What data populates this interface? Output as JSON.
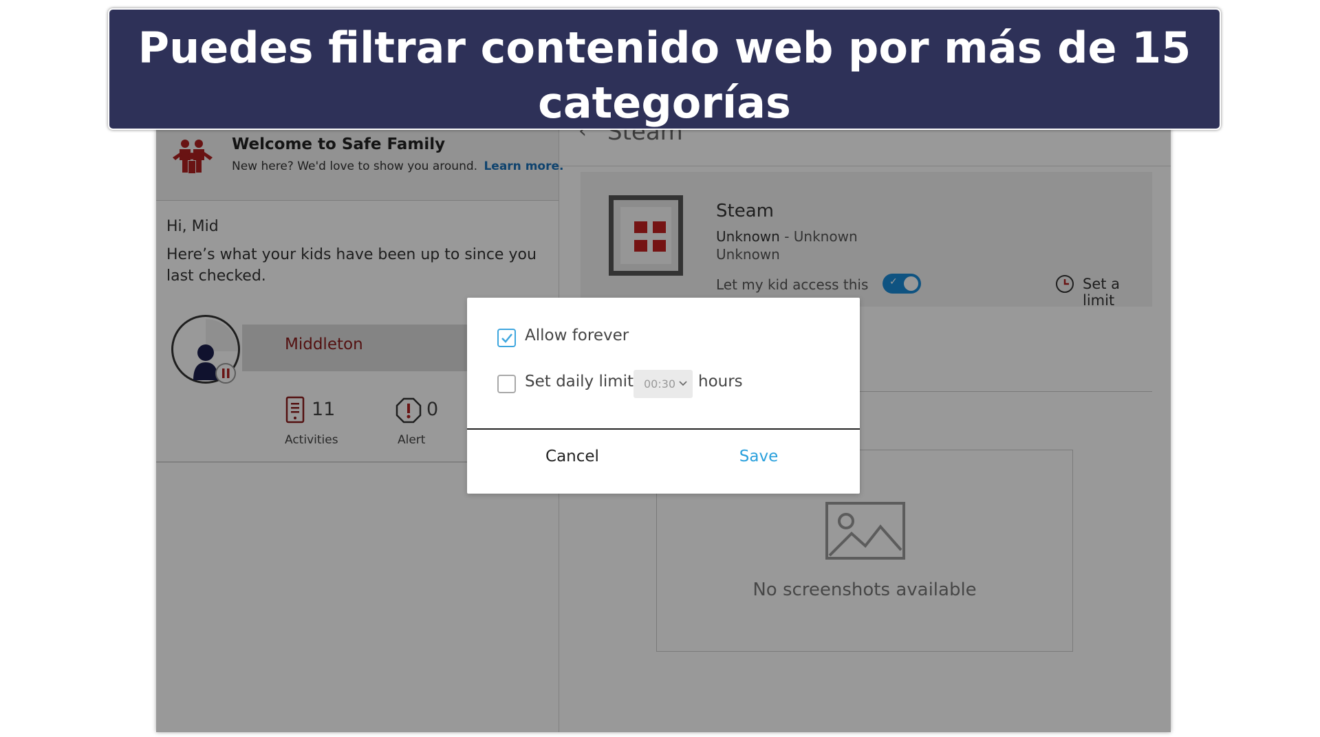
{
  "banner": {
    "text": "Puedes filtrar contenido web por más de 15 categorías"
  },
  "welcome": {
    "title": "Welcome to Safe Family",
    "subtitle": "New here? We'd love to show you around.",
    "learn_more": "Learn more."
  },
  "greeting": {
    "title": "Hi, Mid",
    "subtitle": "Here’s what your kids have been up to since you last checked."
  },
  "child": {
    "name": "Middleton",
    "activities_count": "11",
    "activities_label": "Activities",
    "alert_count": "0",
    "alert_label": "Alert"
  },
  "app": {
    "breadcrumb": "Steam",
    "name": "Steam",
    "developer": "Unknown",
    "developer_sep": " - ",
    "publisher": "Unknown",
    "category": "Unknown",
    "access_label": "Let my kid access this",
    "access_enabled": true,
    "limit_label": "Set a limit",
    "no_screenshots": "No screenshots available"
  },
  "dialog": {
    "allow_forever_label": "Allow forever",
    "allow_forever_checked": true,
    "daily_limit_label": "Set daily limit",
    "daily_limit_checked": false,
    "daily_limit_value": "00:30",
    "hours_label": "hours",
    "cancel_label": "Cancel",
    "save_label": "Save"
  },
  "colors": {
    "banner_bg": "#2e3158",
    "accent_blue": "#1a8ad8",
    "brand_red": "#c42121",
    "link_blue": "#1a70b8",
    "save_blue": "#2aa0dc"
  }
}
